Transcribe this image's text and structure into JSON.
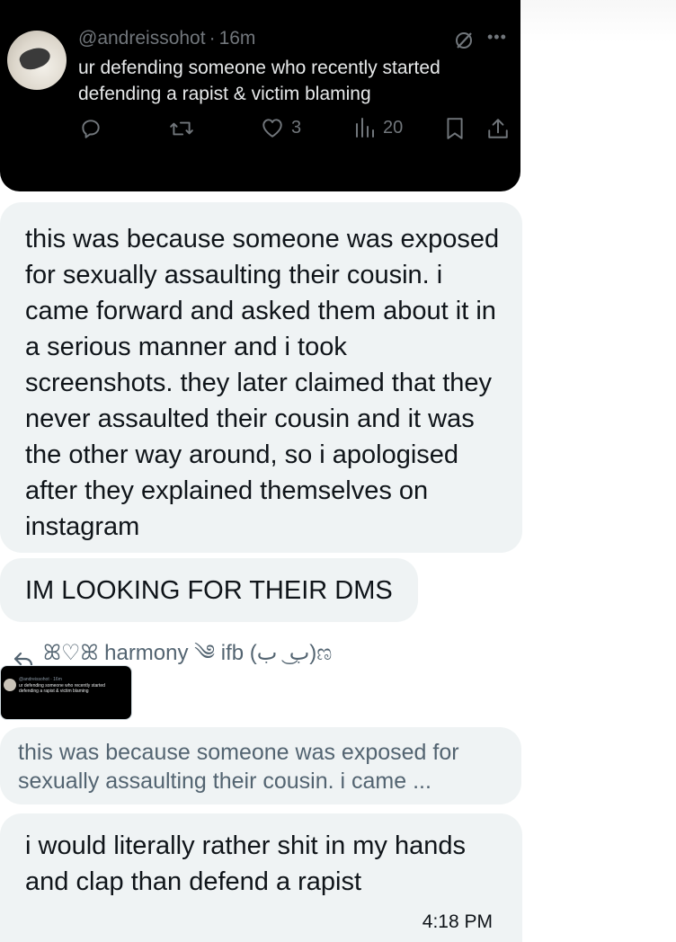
{
  "quoted_tweet": {
    "handle": "@andreissohot",
    "separator": "·",
    "time": "16m",
    "text": "ur defending someone who recently started defending a rapist & victim blaming",
    "actions": {
      "reply_icon": "reply-icon",
      "retweet_icon": "retweet-icon",
      "like_icon": "heart-icon",
      "likes": "3",
      "views_icon": "views-chart-icon",
      "views": "20",
      "bookmark_icon": "bookmark-icon",
      "share_icon": "share-icon"
    }
  },
  "messages": [
    {
      "text": "this was because someone was exposed for sexually assaulting their cousin. i came forward and asked them about it in a serious manner and i took screenshots. they later claimed that they never assaulted their cousin and it was the other way around, so i apologised after they explained themselves on instagram"
    },
    {
      "text": "IM LOOKING FOR THEIR DMS"
    }
  ],
  "reply_context": {
    "icon": "reply-arrow-icon",
    "name": "ꕤ♡ꕤ harmony ༄ ifb (ب ͜ ب)ಣ"
  },
  "thumbnail": {
    "line1": "@andreissohot · 16m",
    "line2": "ur defending someone who recently started",
    "line3": "defending a rapist & victim blaming"
  },
  "quoted_message": {
    "text": "this was because someone was exposed for sexually assaulting their cousin. i came ..."
  },
  "last_message": {
    "text": "i would literally rather shit in my hands and clap than defend a rapist",
    "time": "4:18 PM"
  },
  "colors": {
    "bubble": "#eff3f4",
    "tweet_bg": "#000000",
    "muted": "#71767b"
  }
}
